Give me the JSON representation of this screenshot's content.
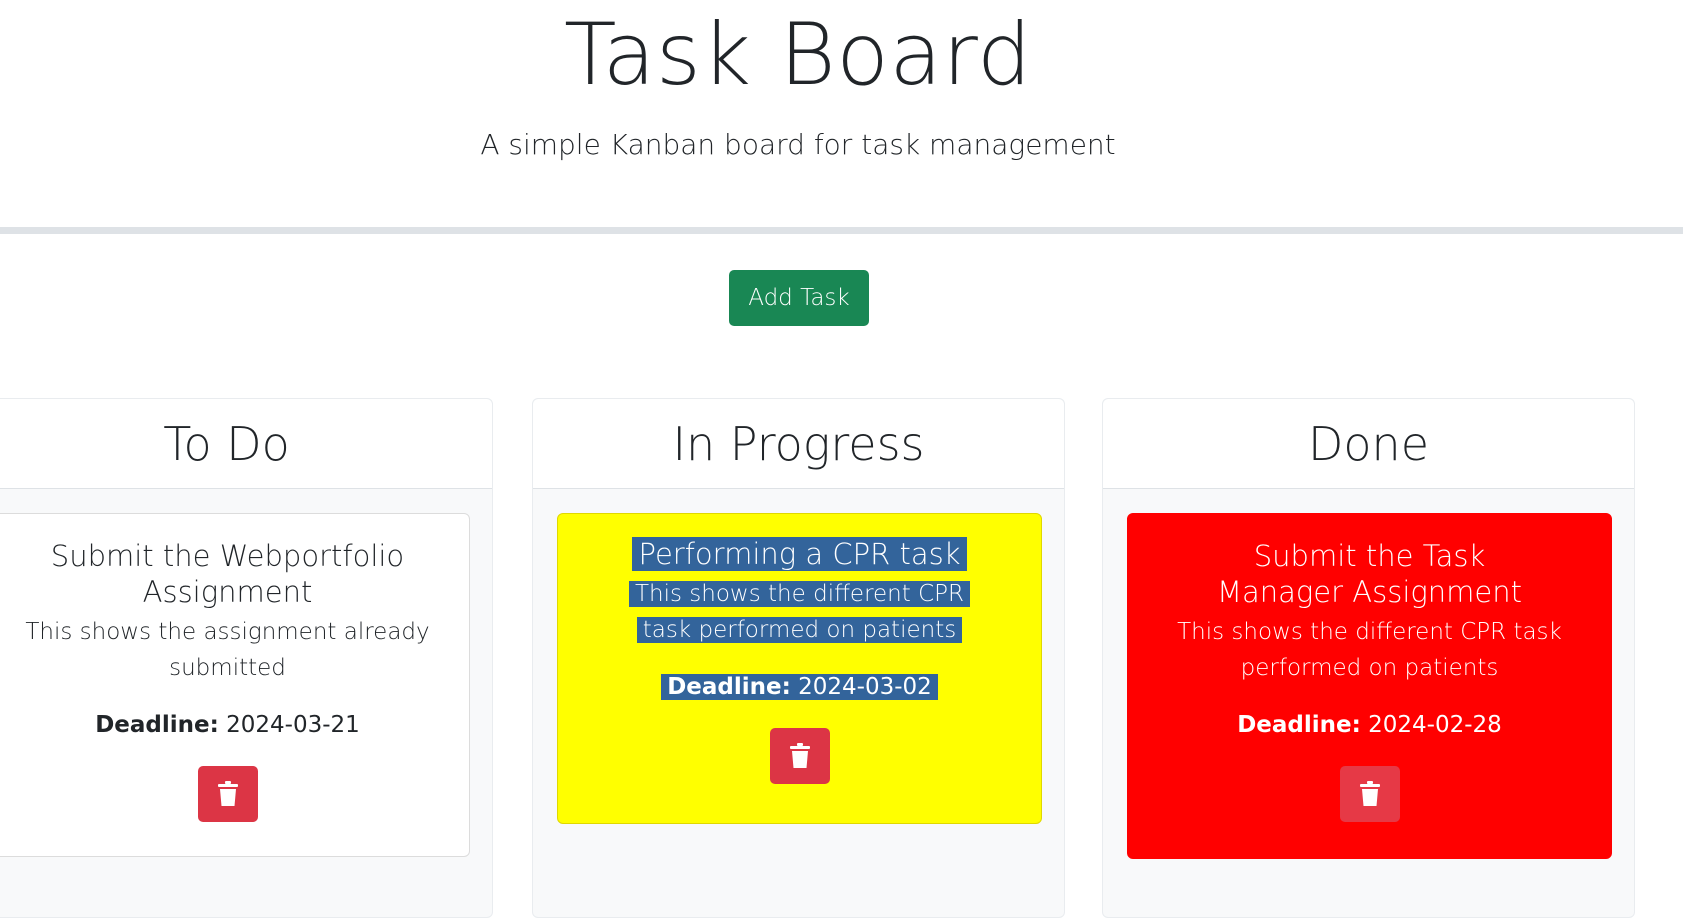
{
  "header": {
    "title": "Task Board",
    "subtitle": "A simple Kanban board for task management"
  },
  "toolbar": {
    "add_task_label": "Add Task"
  },
  "lanes": [
    {
      "title": "To Do",
      "cards": [
        {
          "title": "Submit the Webportfolio Assignment",
          "description": "This shows the assignment already submitted",
          "deadline_label": "Deadline:",
          "deadline": "2024-03-21",
          "background": "#ffffff",
          "text_color": "#212529",
          "delete_icon": "trash-icon"
        }
      ]
    },
    {
      "title": "In Progress",
      "cards": [
        {
          "title": "Performing a CPR task",
          "description": "This shows the different CPR task performed on patients",
          "deadline_label": "Deadline:",
          "deadline": "2024-03-02",
          "background": "#ffff00",
          "text_color": "#ffffff",
          "text_selected": true,
          "delete_icon": "trash-icon"
        }
      ]
    },
    {
      "title": "Done",
      "cards": [
        {
          "title": "Submit the Task Manager Assignment",
          "description": "This shows the different CPR task performed on patients",
          "deadline_label": "Deadline:",
          "deadline": "2024-02-28",
          "background": "#ff0000",
          "text_color": "#ffffff",
          "delete_icon": "trash-icon"
        }
      ]
    }
  ],
  "colors": {
    "add_button": "#198754",
    "delete_button": "#dc3545",
    "selection_highlight": "#33649b"
  }
}
